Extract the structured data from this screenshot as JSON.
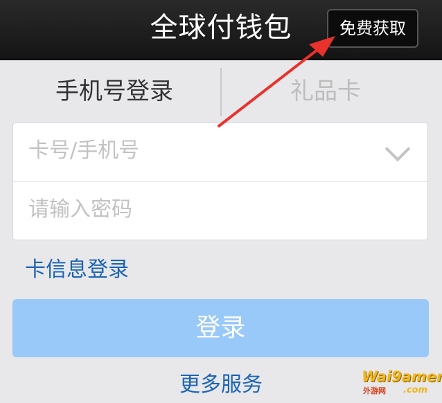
{
  "header": {
    "title": "全球付钱包",
    "free_button": "免费获取"
  },
  "tabs": [
    {
      "label": "手机号登录",
      "active": true
    },
    {
      "label": "礼品卡",
      "active": false
    }
  ],
  "form": {
    "card_placeholder": "卡号/手机号",
    "password_placeholder": "请输入密码",
    "dropdown_icon": "chevron-down-icon"
  },
  "card_login_link": "卡信息登录",
  "login_button": "登录",
  "more_services": "更多服务",
  "annotation": {
    "icon": "red-arrow-icon",
    "color": "#e8322b"
  },
  "watermark": {
    "main": "Wai9amer",
    "sub": "外游网",
    "suffix": ".com"
  },
  "colors": {
    "link": "#1a64b4",
    "login_button": "#99c9f9",
    "topbar": "#1a1a1a"
  }
}
